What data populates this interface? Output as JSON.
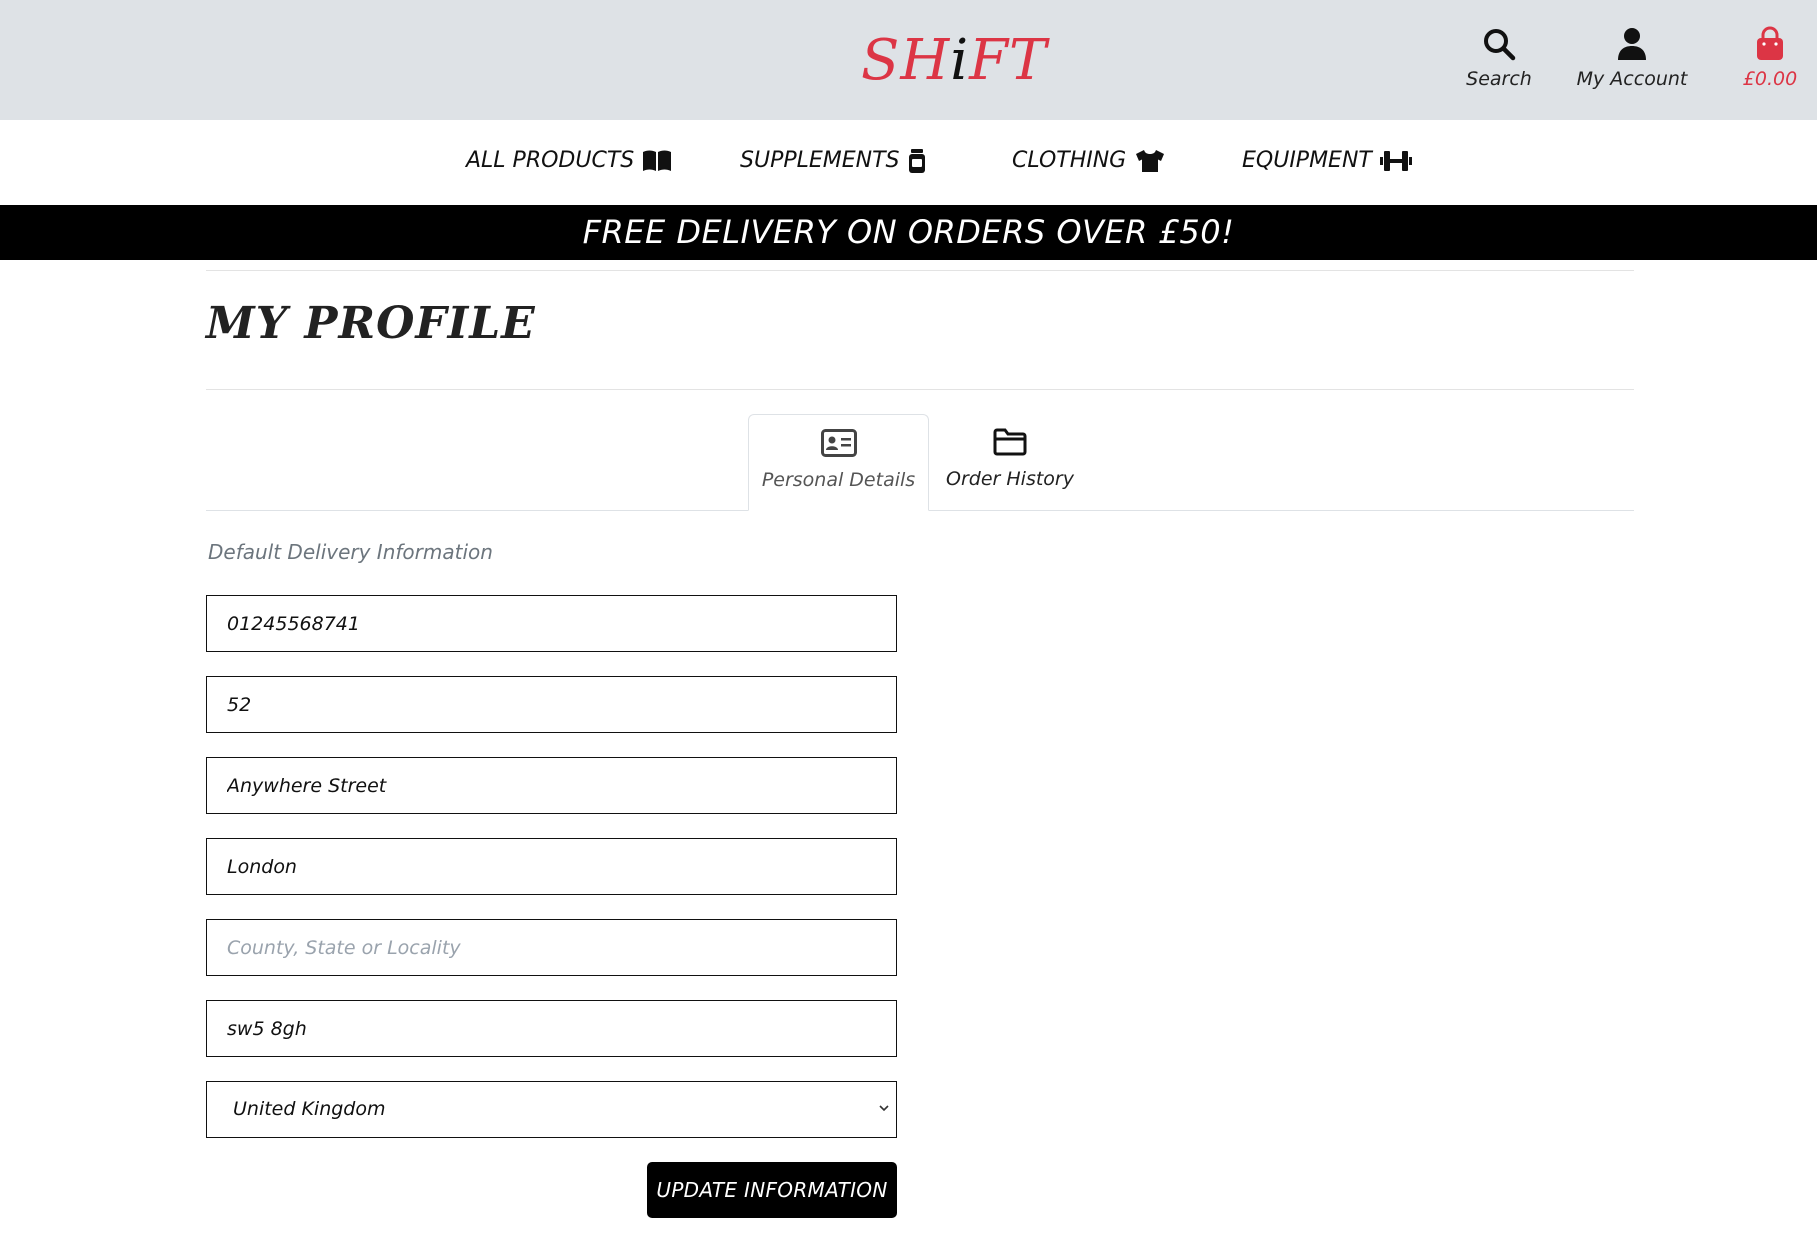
{
  "header": {
    "logo_prefix": "SH",
    "logo_i": "i",
    "logo_suffix": "FT",
    "search_label": "Search",
    "account_label": "My Account",
    "cart_total": "£0.00",
    "brand_color": "#dc3545"
  },
  "nav": {
    "items": [
      {
        "label": "ALL PRODUCTS",
        "icon": "book-open-icon"
      },
      {
        "label": "SUPPLEMENTS",
        "icon": "supplement-jar-icon"
      },
      {
        "label": "CLOTHING",
        "icon": "tshirt-icon"
      },
      {
        "label": "EQUIPMENT",
        "icon": "dumbbell-icon"
      }
    ]
  },
  "banner": {
    "text": "FREE DELIVERY ON ORDERS OVER £50!"
  },
  "page": {
    "title": "MY PROFILE"
  },
  "tabs": [
    {
      "label": "Personal Details",
      "icon": "id-card-icon",
      "active": true
    },
    {
      "label": "Order History",
      "icon": "folder-icon",
      "active": false
    }
  ],
  "form": {
    "section_label": "Default Delivery Information",
    "phone": "01245568741",
    "street1": "52",
    "street2": "Anywhere Street",
    "town": "London",
    "county_value": "",
    "county_placeholder": "County, State or Locality",
    "postcode": "sw5 8gh",
    "country": "United Kingdom",
    "submit_label": "UPDATE INFORMATION"
  }
}
